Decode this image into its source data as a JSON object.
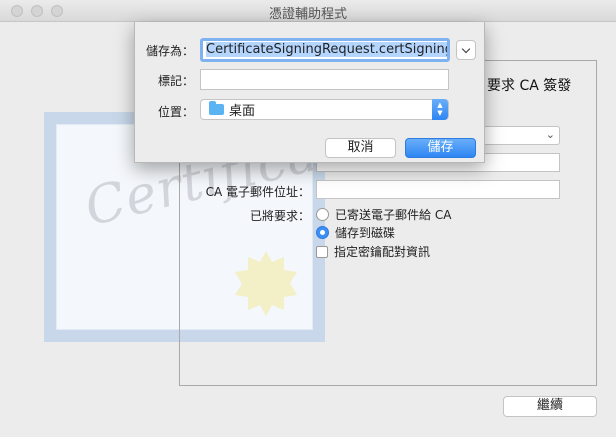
{
  "window": {
    "title": "憑證輔助程式",
    "traffic_lights": [
      "close",
      "minimize",
      "zoom"
    ]
  },
  "panel": {
    "heading_tail": "要求 CA 簽發",
    "obscured_label": "CA 電子郵件位址：",
    "email_label": "CA 電子郵件位址：",
    "request_label": "已將要求：",
    "options": {
      "email_ca": "已寄送電子郵件給 CA",
      "save_disk": "儲存到磁碟",
      "specify_keypair": "指定密鑰配對資訊"
    },
    "selected_option": "save_disk",
    "continue_label": "繼續"
  },
  "dialog": {
    "save_as_label": "儲存為：",
    "save_as_value": "CertificateSigningRequest.certSigningRe",
    "tags_label": "標記：",
    "tags_value": "",
    "where_label": "位置：",
    "where_value": "桌面",
    "cancel_label": "取消",
    "save_label": "儲存"
  },
  "certificate_art": {
    "word": "Certificate"
  },
  "colors": {
    "accent": "#2e86f3",
    "selection": "#b4d5fe"
  }
}
